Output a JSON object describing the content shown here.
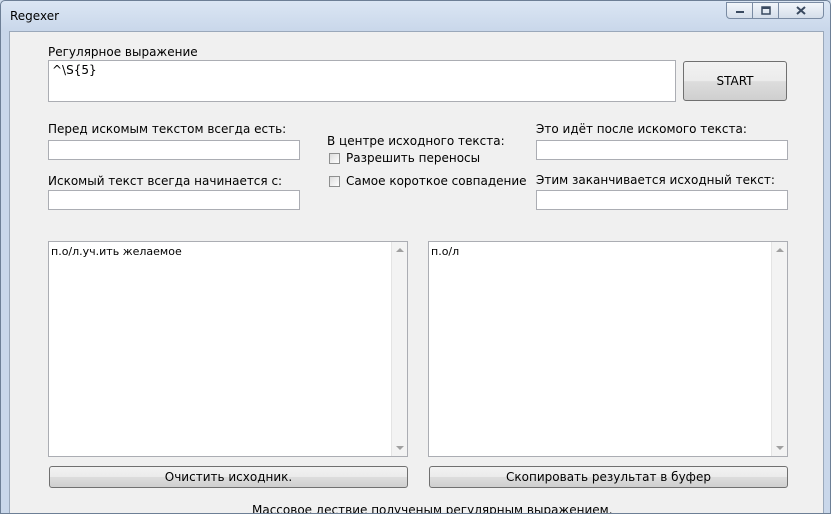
{
  "window": {
    "title": "Regexer"
  },
  "regex": {
    "label": "Регулярное выражение",
    "value": "^\\S{5}"
  },
  "start_button": "START",
  "before": {
    "label": "Перед искомым текстом всегда есть:",
    "value": ""
  },
  "starts": {
    "label": "Искомый текст всегда начинается с:",
    "value": ""
  },
  "center": {
    "label": "В центре исходного текста:",
    "opt1": {
      "label": "Разрешить переносы",
      "checked": false
    },
    "opt2": {
      "label": "Самое короткое совпадение",
      "checked": false
    }
  },
  "after": {
    "label": "Это идёт после искомого текста:",
    "value": ""
  },
  "ends": {
    "label": "Этим заканчивается исходный текст:",
    "value": ""
  },
  "source_text": "п.о/л.уч.ить желаемое",
  "result_text": "п.о/л",
  "clear_button": "Очистить исходник.",
  "copy_button": "Скопировать результат в буфер",
  "footer_text": "Массовое дествие полученым регулярным выражением."
}
